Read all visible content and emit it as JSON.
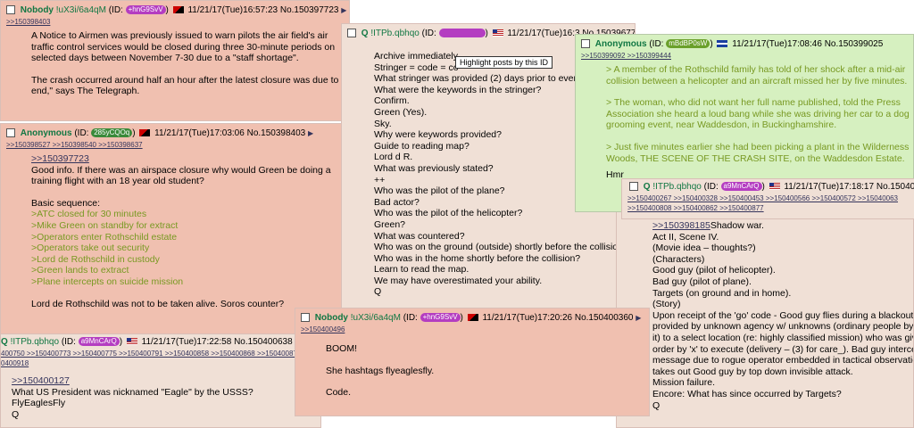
{
  "posts": {
    "p1": {
      "name": "Nobody",
      "trip": "!uX3i/6a4qM",
      "id_prefix": "(ID: ",
      "id": "+hnG9SvV",
      "id_suffix": ")",
      "datetime": "11/21/17(Tue)16:57:23",
      "number": "No.150397723",
      "replies": ">>150398403",
      "lines": [
        "A Notice to Airmen was previously issued to warn pilots the air field's air",
        "traffic control services would be closed during three 30-minute periods on",
        "selected days between November 7-30 due to a \"staff shortage\".",
        "",
        "The crash occurred around half an hour after the latest closure was due to",
        "end,\" says The Telegraph."
      ]
    },
    "p2": {
      "name": "Anonymous",
      "id_prefix": "(ID: ",
      "id": "285yCQOq",
      "id_suffix": ")",
      "datetime": "11/21/17(Tue)17:03:06",
      "number": "No.150398403",
      "replies": ">>150398527 >>150398540 >>150398637",
      "quote": ">>150397723",
      "lines": [
        "Good info. If there was an airspace closure why would Green be doing a",
        "training flight with an 18 year old student?",
        "",
        "Basic sequence:"
      ],
      "greentext": [
        ">ATC closed for 30 minutes",
        ">Mike Green on standby for extract",
        ">Operators enter Rothschild estate",
        ">Operators take out security",
        ">Lord de Rothschild in custody",
        ">Green lands to extract",
        ">Plane intercepts on suicide mission"
      ],
      "closing": "Lord de Rothschild was not to be taken alive. Soros counter?"
    },
    "p3": {
      "name": "Q",
      "trip": "!ITPb.qbhqo",
      "id_prefix": "(ID: ",
      "id": "",
      "id_suffix": ")",
      "datetime": "11/21/17(Tue)16:3",
      "number": "No.150396774",
      "lines": [
        "Archive immediately",
        "Stringer = code = co",
        "What stringer was provided (2) days prior to event",
        "What were the keywords in the stringer?",
        "Confirm.",
        "Green (Yes).",
        "Sky.",
        "Why were keywords provided?",
        "Guide to reading map?",
        "Lord d R.",
        "What was previously stated?",
        "++",
        "Who was the pilot of the plane?",
        "Bad actor?",
        "Who was the pilot of the helicopter?",
        "Green?",
        "What was countered?",
        "Who was on the ground (outside) shortly before the collision?",
        "Who was in the home shortly before the collision?",
        "Learn to read the map.",
        "We may have overestimated your ability.",
        "Q"
      ],
      "tooltip": "Highlight posts by this ID"
    },
    "p4": {
      "name": "Anonymous",
      "id_prefix": "(ID: ",
      "id": "mBdBP0sW",
      "id_suffix": ")",
      "datetime": "11/21/17(Tue)17:08:46",
      "number": "No.150399025",
      "replies": ">>150399092 >>150399444",
      "lines": [
        "> A member of the Rothschild family has told of her shock after a mid-air",
        "collision between a helicopter and an aircraft missed her by five minutes.",
        "",
        "> The woman, who did not want her full name published, told the Press",
        "Association she heard a loud bang while she was driving her car to a dog",
        "grooming event, near Waddesdon, in Buckinghamshire.",
        "",
        "> Just five minutes earlier she had been picking a plant in the Wilderness",
        "Woods, THE SCENE OF THE CRASH SITE, on the Waddesdon Estate."
      ],
      "trailing": "Hmr"
    },
    "p5": {
      "name": "Q",
      "trip": "!ITPb.qbhqo",
      "id_prefix": "(ID: ",
      "id": "a9MnCArQ",
      "id_suffix": ")",
      "datetime": "11/21/17(Tue)17:18:17",
      "number": "No.15040",
      "replies1": ">>150400267 >>150400328 >>150400453 >>150400566 >>150400572 >>15040063",
      "replies2": ">>150400808 >>150400862 >>150400877",
      "quote": ">>150398185",
      "quote_after": "Shadow war.",
      "lines": [
        "Act II, Scene IV.",
        "(Movie idea – thoughts?)",
        "(Characters)",
        "Good guy (pilot of helicopter).",
        "Bad guy (pilot of plane).",
        "Targets (on ground and in home).",
        "(Story)",
        "Upon receipt of the 'go' code - Good guy flies during a blackout w",
        "provided by unknown agency w/ unknowns (ordinary people by th",
        "it) to a select location (re: highly classified mission) who was give",
        "order by 'x' to execute (delivery – (3) for care_). Bad guy intercep",
        "message due to rogue operator embedded in tactical observatio",
        "takes out Good guy by top down invisible attack.",
        "Mission failure.",
        "Encore: What has since occurred by Targets?",
        "Q"
      ]
    },
    "p6": {
      "name": "Q",
      "trip": "!ITPb.qbhqo",
      "id_prefix": "(ID: ",
      "id": "a9MnCArQ",
      "id_suffix": ")",
      "datetime": "11/21/17(Tue)17:22:58",
      "number": "No.150400638",
      "replies1": "400750 >>150400773 >>150400775 >>150400791 >>150400858 >>150400868 >>15040087",
      "replies2": "0400918",
      "quote": ">>150400127",
      "lines": [
        "What US President was nicknamed \"Eagle\" by the USSS?",
        "FlyEaglesFly",
        "Q"
      ]
    },
    "p7": {
      "name": "Nobody",
      "trip": "!uX3i/6a4qM",
      "id_prefix": "(ID: ",
      "id": "+hnG9SvV",
      "id_suffix": ")",
      "datetime": "11/21/17(Tue)17:20:26",
      "number": "No.150400360",
      "replies": ">>150400496",
      "lines": [
        "BOOM!",
        "",
        "She hashtags flyeaglesfly.",
        "",
        "Code."
      ]
    }
  },
  "colors": {
    "red_post": "#f0c0b0",
    "green_post": "#d6f0c0",
    "pale_post": "#f0e0d6",
    "name_green": "#117743",
    "greentext": "#789922",
    "link": "#34345c"
  },
  "icons": {
    "checkbox": "checkbox-icon",
    "arrow": "menu-arrow-icon",
    "flag": "flag-icon"
  }
}
